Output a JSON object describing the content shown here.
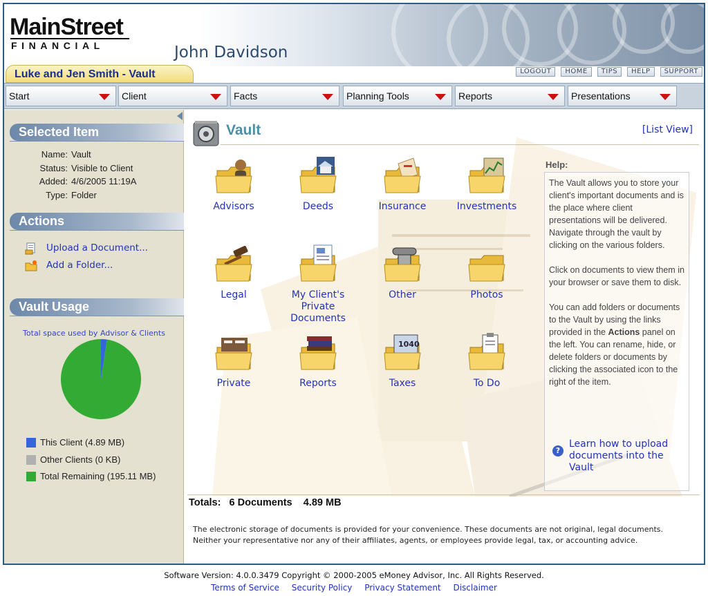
{
  "header": {
    "logo_line1": "MainStreet",
    "logo_line2": "FINANCIAL",
    "user_name": "John Davidson",
    "client_tab": "Luke and Jen Smith - Vault",
    "top_links": [
      "LOGOUT",
      "HOME",
      "TIPS",
      "HELP",
      "SUPPORT"
    ]
  },
  "nav": [
    "Start",
    "Client",
    "Facts",
    "Planning Tools",
    "Reports",
    "Presentations"
  ],
  "sidebar": {
    "selected_item": {
      "heading": "Selected Item",
      "fields": [
        {
          "key": "Name:",
          "value": "Vault"
        },
        {
          "key": "Status:",
          "value": "Visible to Client"
        },
        {
          "key": "Added:",
          "value": "4/6/2005 11:19A"
        },
        {
          "key": "Type:",
          "value": "Folder"
        }
      ]
    },
    "actions": {
      "heading": "Actions",
      "items": [
        "Upload a Document...",
        "Add a Folder..."
      ]
    },
    "vault_usage": {
      "heading": "Vault Usage",
      "caption": "Total space used by Advisor & Clients",
      "legend": [
        {
          "label": "This Client (4.89 MB)",
          "color": "#3366dd"
        },
        {
          "label": "Other Clients (0 KB)",
          "color": "#b0b0b0"
        },
        {
          "label": "Total Remaining (195.11 MB)",
          "color": "#33aa33"
        }
      ]
    }
  },
  "chart_data": {
    "type": "pie",
    "title": "Total space used by Advisor & Clients",
    "categories": [
      "This Client",
      "Other Clients",
      "Total Remaining"
    ],
    "values": [
      4.89,
      0,
      195.11
    ],
    "units": "MB",
    "colors": [
      "#3366dd",
      "#b0b0b0",
      "#33aa33"
    ]
  },
  "main": {
    "title": "Vault",
    "list_view": "[List View]",
    "folders": [
      {
        "label": "Advisors",
        "icon": "advisor-person-icon"
      },
      {
        "label": "Deeds",
        "icon": "house-icon"
      },
      {
        "label": "Insurance",
        "icon": "insurance-doc-icon"
      },
      {
        "label": "Investments",
        "icon": "stock-chart-icon"
      },
      {
        "label": "Legal",
        "icon": "gavel-icon"
      },
      {
        "label": "My Client's Private Documents",
        "icon": "document-icon"
      },
      {
        "label": "Other",
        "icon": "telephone-icon"
      },
      {
        "label": "Photos",
        "icon": "folder-icon"
      },
      {
        "label": "Private",
        "icon": "private-papers-icon"
      },
      {
        "label": "Reports",
        "icon": "books-icon"
      },
      {
        "label": "Taxes",
        "icon": "tax-1040-icon"
      },
      {
        "label": "To Do",
        "icon": "clipboard-icon"
      }
    ],
    "help": {
      "title": "Help:",
      "p1": "The Vault allows you to store your client's important documents and is the place where client presentations will be delivered. Navigate through the vault by clicking on the various folders.",
      "p2": "Click on documents to view them in your browser or save them to disk.",
      "p3_before": "You can add folders or documents to the Vault by using the links provided in the ",
      "p3_bold": "Actions",
      "p3_after": " panel on the left. You can rename, hide, or delete folders or documents by clicking the associated icon to the right of the item.",
      "link": "Learn how to upload documents into the Vault"
    },
    "totals_label": "Totals:",
    "totals_docs": "6 Documents",
    "totals_size": "4.89 MB",
    "disclaimer": "The electronic storage of documents is provided for your convenience. These documents are not original, legal documents. Neither your representative nor any of their affiliates, agents, or employees provide legal, tax, or accounting advice."
  },
  "footer": {
    "version": "Software Version: 4.0.0.3479 Copyright © 2000-2005 eMoney Advisor, Inc. All Rights Reserved.",
    "links": [
      "Terms of Service",
      "Security Policy",
      "Privacy Statement",
      "Disclaimer"
    ]
  }
}
